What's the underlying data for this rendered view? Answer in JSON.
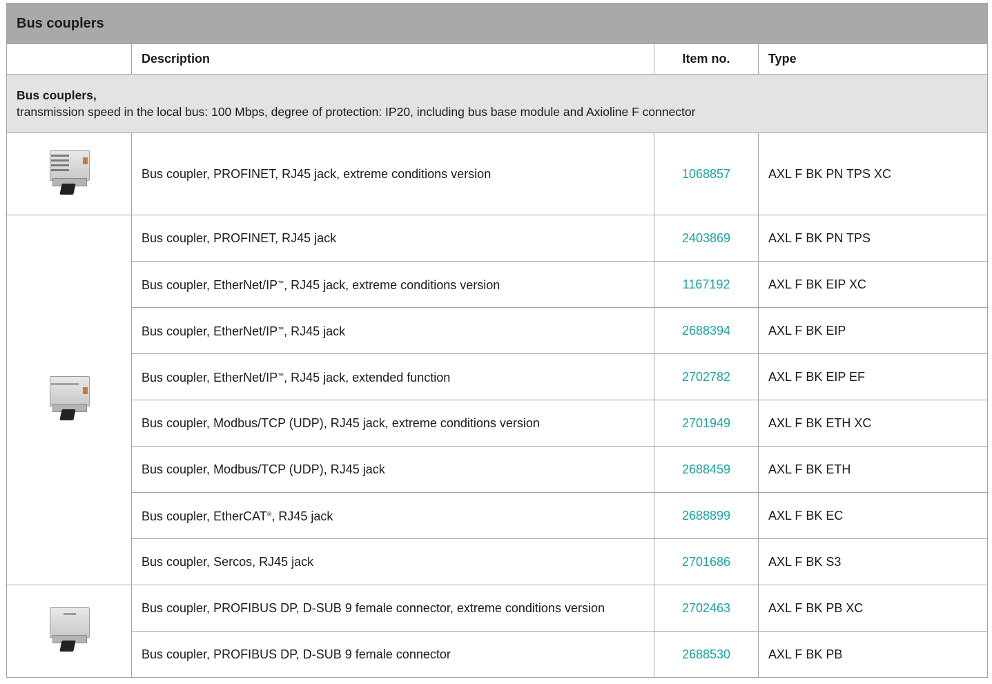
{
  "table_title": "Bus couplers",
  "columns": {
    "description": "Description",
    "item_no": "Item no.",
    "type": "Type"
  },
  "group": {
    "title": "Bus couplers,",
    "subtitle": "transmission speed in the local bus: 100 Mbps, degree of protection: IP20, including bus base module and Axioline F connector"
  },
  "rows": [
    {
      "description": "Bus coupler, PROFINET, RJ45 jack, extreme conditions version",
      "item_no": "1068857",
      "type": "AXL F BK PN TPS XC"
    },
    {
      "description": "Bus coupler, PROFINET, RJ45 jack",
      "item_no": "2403869",
      "type": "AXL F BK PN TPS"
    },
    {
      "description_pre": "Bus coupler, EtherNet/IP",
      "description_mark": "™",
      "description_post": ", RJ45 jack, extreme conditions version",
      "item_no": "1167192",
      "type": "AXL F BK EIP XC"
    },
    {
      "description_pre": "Bus coupler, EtherNet/IP",
      "description_mark": "™",
      "description_post": ", RJ45 jack",
      "item_no": "2688394",
      "type": "AXL F BK EIP"
    },
    {
      "description_pre": "Bus coupler, EtherNet/IP",
      "description_mark": "™",
      "description_post": ", RJ45 jack, extended function",
      "item_no": "2702782",
      "type": "AXL F BK EIP EF"
    },
    {
      "description": "Bus coupler, Modbus/TCP (UDP), RJ45 jack, extreme conditions version",
      "item_no": "2701949",
      "type": "AXL F BK ETH XC"
    },
    {
      "description": "Bus coupler, Modbus/TCP (UDP), RJ45 jack",
      "item_no": "2688459",
      "type": "AXL F BK ETH"
    },
    {
      "description_pre": "Bus coupler, EtherCAT",
      "description_mark": "®",
      "description_post": ", RJ45 jack",
      "item_no": "2688899",
      "type": "AXL F BK EC"
    },
    {
      "description": "Bus coupler, Sercos, RJ45 jack",
      "item_no": "2701686",
      "type": "AXL F BK S3"
    },
    {
      "description": "Bus coupler, PROFIBUS DP, D-SUB 9 female connector, extreme conditions version",
      "item_no": "2702463",
      "type": "AXL F BK PB XC"
    },
    {
      "description": "Bus coupler, PROFIBUS DP, D-SUB 9 female connector",
      "item_no": "2688530",
      "type": "AXL F BK PB"
    }
  ],
  "colors": {
    "title_bg": "#a9a9a9",
    "group_bg": "#e3e3e3",
    "link": "#1aa3a3",
    "border": "#a4a4a4"
  },
  "icons": [
    "bus-coupler-xc-image",
    "bus-coupler-image",
    "bus-coupler-profibus-image"
  ]
}
